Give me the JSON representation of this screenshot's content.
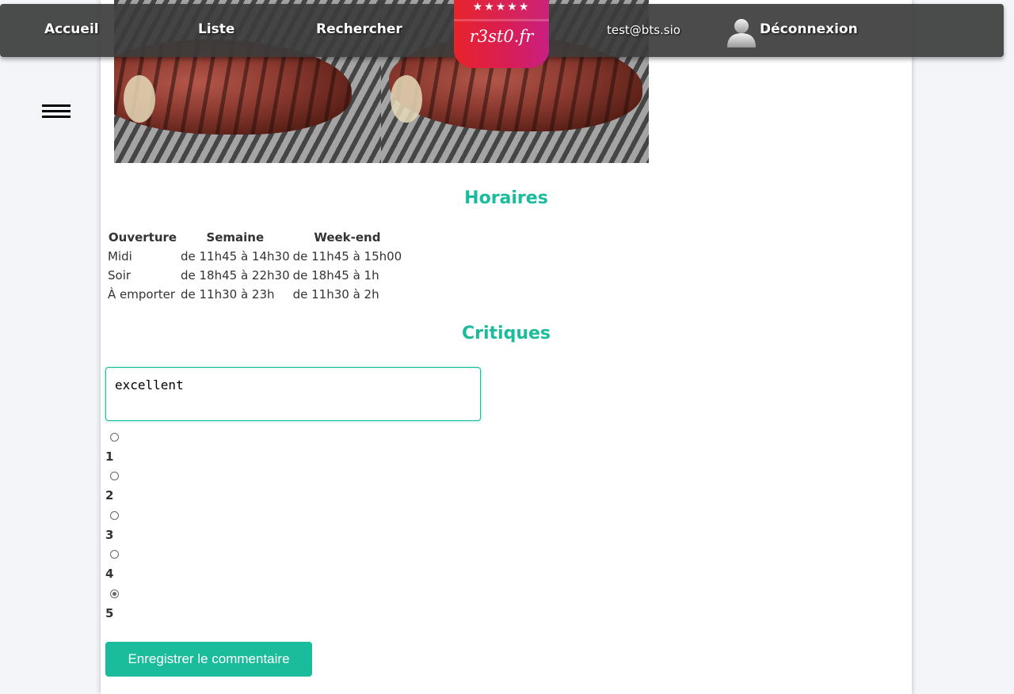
{
  "navbar": {
    "links": [
      "Accueil",
      "Liste",
      "Rechercher"
    ],
    "logo_text": "r3st0.fr",
    "logo_stars": "★★★★★",
    "user_email": "test@bts.sio",
    "logout_label": "Déconnexion"
  },
  "hours": {
    "title": "Horaires",
    "headers": [
      "Ouverture",
      "Semaine",
      "Week-end"
    ],
    "rows": [
      [
        "Midi",
        "de 11h45 à 14h30",
        "de 11h45 à 15h00"
      ],
      [
        "Soir",
        "de 18h45 à 22h30",
        "de 18h45 à 1h"
      ],
      [
        "À emporter",
        "de 11h30 à 23h",
        "de 11h30 à 2h"
      ]
    ]
  },
  "reviews": {
    "title": "Critiques",
    "comment_value": "excellent",
    "ratings": [
      "1",
      "2",
      "3",
      "4",
      "5"
    ],
    "selected_rating": "5",
    "submit_label": "Enregistrer le commentaire"
  },
  "colors": {
    "accent": "#1abc9c",
    "navbar_bg": "#3c3c3c",
    "page_bg": "#f3f5f9"
  }
}
